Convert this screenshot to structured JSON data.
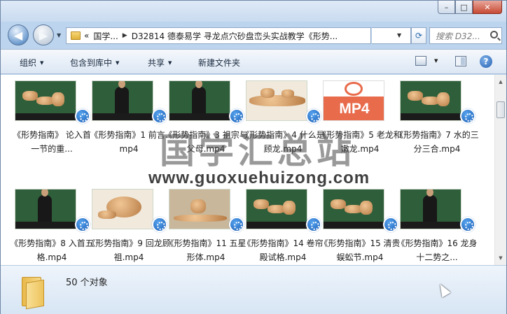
{
  "window": {
    "caption_buttons": {
      "minimize": "–",
      "maximize": "□",
      "close": "✕"
    }
  },
  "navigation": {
    "back_glyph": "◀",
    "forward_glyph": "▶",
    "breadcrumb": {
      "overflow": "«",
      "segments": [
        "国学...",
        "D32814 德泰易学 寻龙点穴砂盘峦头实战教学《形势..."
      ]
    },
    "search_placeholder": "搜索 D32..."
  },
  "toolbar": {
    "organize": "组织",
    "include_in_library": "包含到库中",
    "share": "共享",
    "new_folder": "新建文件夹"
  },
  "files": [
    {
      "name": "《形势指南》 论入首一节的重...",
      "thumb": "board-spiral"
    },
    {
      "name": "《形势指南》1 前言.mp4",
      "thumb": "board-person"
    },
    {
      "name": "《形势指南》3 祖宗与父母.mp4",
      "thumb": "board-person"
    },
    {
      "name": "《形势指南》4 什么是顾龙.mp4",
      "thumb": "sand-ridge"
    },
    {
      "name": "《形势指南》5 老龙和嫩龙.mp4",
      "thumb": "mp4"
    },
    {
      "name": "《形势指南》7 水的三分三合.mp4",
      "thumb": "board-spiral"
    },
    {
      "name": "《形势指南》8 入首五格.mp4",
      "thumb": "board-person"
    },
    {
      "name": "《形势指南》9 回龙顾祖.mp4",
      "thumb": "sand-spiral"
    },
    {
      "name": "《形势指南》11 五星形体.mp4",
      "thumb": "sand-hills"
    },
    {
      "name": "《形势指南》14 卷帘殿试格.mp4",
      "thumb": "board-spiral"
    },
    {
      "name": "《形势指南》15 清贵蜈蚣节.mp4",
      "thumb": "board-spiral"
    },
    {
      "name": "《形势指南》16 龙身十二势之...",
      "thumb": "board-person"
    }
  ],
  "mp4_label": "MP4",
  "status": {
    "object_count": "50 个对象"
  },
  "watermark": {
    "title": "国学汇总站",
    "url": "www.guoxuehuizong.com"
  }
}
